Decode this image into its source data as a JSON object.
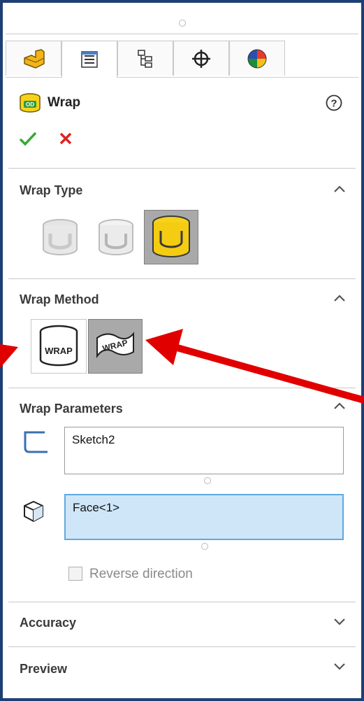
{
  "panel": {
    "title": "Wrap",
    "help_icon": "question-circle-icon",
    "ok_icon": "check-icon",
    "cancel_icon": "x-icon"
  },
  "tabs": [
    {
      "icon": "feature-manager-icon"
    },
    {
      "icon": "property-manager-icon"
    },
    {
      "icon": "configuration-manager-icon"
    },
    {
      "icon": "dimxpert-icon"
    },
    {
      "icon": "appearance-manager-icon"
    }
  ],
  "sections": {
    "wrap_type": {
      "title": "Wrap Type",
      "options": [
        "emboss",
        "deboss",
        "scribe"
      ],
      "selected": "scribe"
    },
    "wrap_method": {
      "title": "Wrap Method",
      "options": [
        {
          "icon": "wrap-analytical-icon",
          "text": "WRAP"
        },
        {
          "icon": "wrap-spline-icon",
          "text": "WRAP"
        }
      ],
      "selected": 1
    },
    "wrap_parameters": {
      "title": "Wrap Parameters",
      "sketch_value": "Sketch2",
      "face_value": "Face<1>",
      "reverse_label": "Reverse direction",
      "reverse_checked": false
    },
    "accuracy": {
      "title": "Accuracy"
    },
    "preview": {
      "title": "Preview"
    }
  },
  "colors": {
    "border": "#1d3f73",
    "arrow": "#e00000",
    "ok": "#39a935",
    "cancel": "#e02020",
    "selected_bg": "#a9a9a9",
    "active_field": "#cfe6f9"
  }
}
